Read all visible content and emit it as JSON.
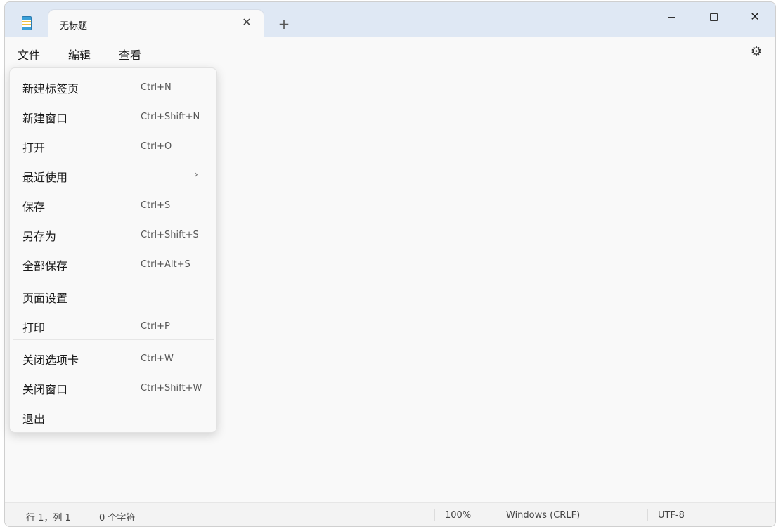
{
  "tab": {
    "title": "无标题",
    "close": "✕",
    "new": "+"
  },
  "window_controls": {
    "close": "✕"
  },
  "menubar": {
    "file": "文件",
    "edit": "编辑",
    "view": "查看",
    "settings_icon": "⚙"
  },
  "file_menu": [
    {
      "label": "新建标签页",
      "shortcut": "Ctrl+N"
    },
    {
      "label": "新建窗口",
      "shortcut": "Ctrl+Shift+N"
    },
    {
      "label": "打开",
      "shortcut": "Ctrl+O"
    },
    {
      "label": "最近使用",
      "arrow": "›"
    },
    {
      "label": "保存",
      "shortcut": "Ctrl+S"
    },
    {
      "label": "另存为",
      "shortcut": "Ctrl+Shift+S"
    },
    {
      "label": "全部保存",
      "shortcut": "Ctrl+Alt+S"
    },
    {
      "label": "页面设置"
    },
    {
      "label": "打印",
      "shortcut": "Ctrl+P"
    },
    {
      "label": "关闭选项卡",
      "shortcut": "Ctrl+W"
    },
    {
      "label": "关闭窗口",
      "shortcut": "Ctrl+Shift+W"
    },
    {
      "label": "退出"
    }
  ],
  "statusbar": {
    "position": "行 1，列 1",
    "char_count": "0 个字符",
    "zoom": "100%",
    "line_ending": "Windows (CRLF)",
    "encoding": "UTF-8"
  }
}
